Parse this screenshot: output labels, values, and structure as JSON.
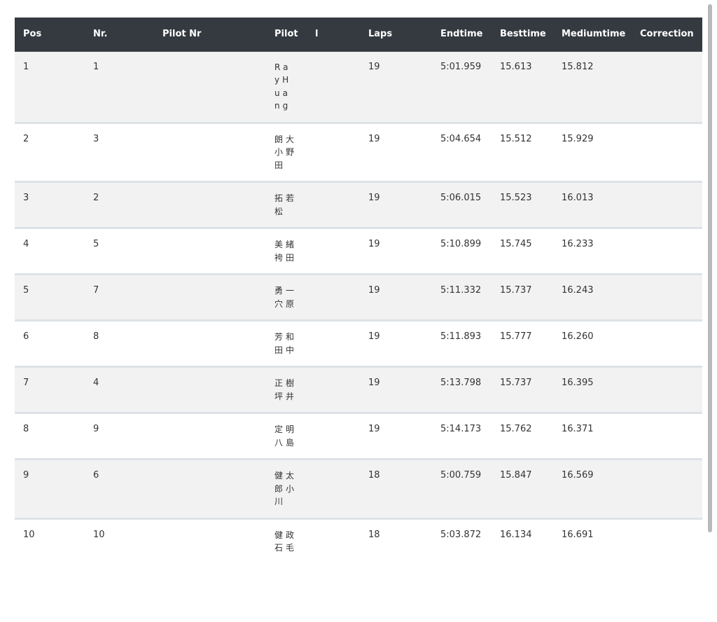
{
  "table": {
    "headers": [
      "Pos",
      "Nr.",
      "Pilot Nr",
      "Pilot",
      "l",
      "Laps",
      "Endtime",
      "Besttime",
      "Mediumtime",
      "Correction"
    ],
    "rows": [
      {
        "pos": "1",
        "nr": "1",
        "pilot_nr": "",
        "pilot": "RayHuang",
        "l": "",
        "laps": "19",
        "endtime": "5:01.959",
        "besttime": "15.613",
        "mediumtime": "15.812",
        "correction": ""
      },
      {
        "pos": "2",
        "nr": "3",
        "pilot_nr": "",
        "pilot": "朗大小野田",
        "l": "",
        "laps": "19",
        "endtime": "5:04.654",
        "besttime": "15.512",
        "mediumtime": "15.929",
        "correction": ""
      },
      {
        "pos": "3",
        "nr": "2",
        "pilot_nr": "",
        "pilot": "拓若松",
        "l": "",
        "laps": "19",
        "endtime": "5:06.015",
        "besttime": "15.523",
        "mediumtime": "16.013",
        "correction": ""
      },
      {
        "pos": "4",
        "nr": "5",
        "pilot_nr": "",
        "pilot": "美緒袴田",
        "l": "",
        "laps": "19",
        "endtime": "5:10.899",
        "besttime": "15.745",
        "mediumtime": "16.233",
        "correction": ""
      },
      {
        "pos": "5",
        "nr": "7",
        "pilot_nr": "",
        "pilot": "勇一穴原",
        "l": "",
        "laps": "19",
        "endtime": "5:11.332",
        "besttime": "15.737",
        "mediumtime": "16.243",
        "correction": ""
      },
      {
        "pos": "6",
        "nr": "8",
        "pilot_nr": "",
        "pilot": "芳和田中",
        "l": "",
        "laps": "19",
        "endtime": "5:11.893",
        "besttime": "15.777",
        "mediumtime": "16.260",
        "correction": ""
      },
      {
        "pos": "7",
        "nr": "4",
        "pilot_nr": "",
        "pilot": "正樹坪井",
        "l": "",
        "laps": "19",
        "endtime": "5:13.798",
        "besttime": "15.737",
        "mediumtime": "16.395",
        "correction": ""
      },
      {
        "pos": "8",
        "nr": "9",
        "pilot_nr": "",
        "pilot": "定明八島",
        "l": "",
        "laps": "19",
        "endtime": "5:14.173",
        "besttime": "15.762",
        "mediumtime": "16.371",
        "correction": ""
      },
      {
        "pos": "9",
        "nr": "6",
        "pilot_nr": "",
        "pilot": "健太郎小川",
        "l": "",
        "laps": "18",
        "endtime": "5:00.759",
        "besttime": "15.847",
        "mediumtime": "16.569",
        "correction": ""
      },
      {
        "pos": "10",
        "nr": "10",
        "pilot_nr": "",
        "pilot": "健政石毛",
        "l": "",
        "laps": "18",
        "endtime": "5:03.872",
        "besttime": "16.134",
        "mediumtime": "16.691",
        "correction": ""
      }
    ]
  }
}
